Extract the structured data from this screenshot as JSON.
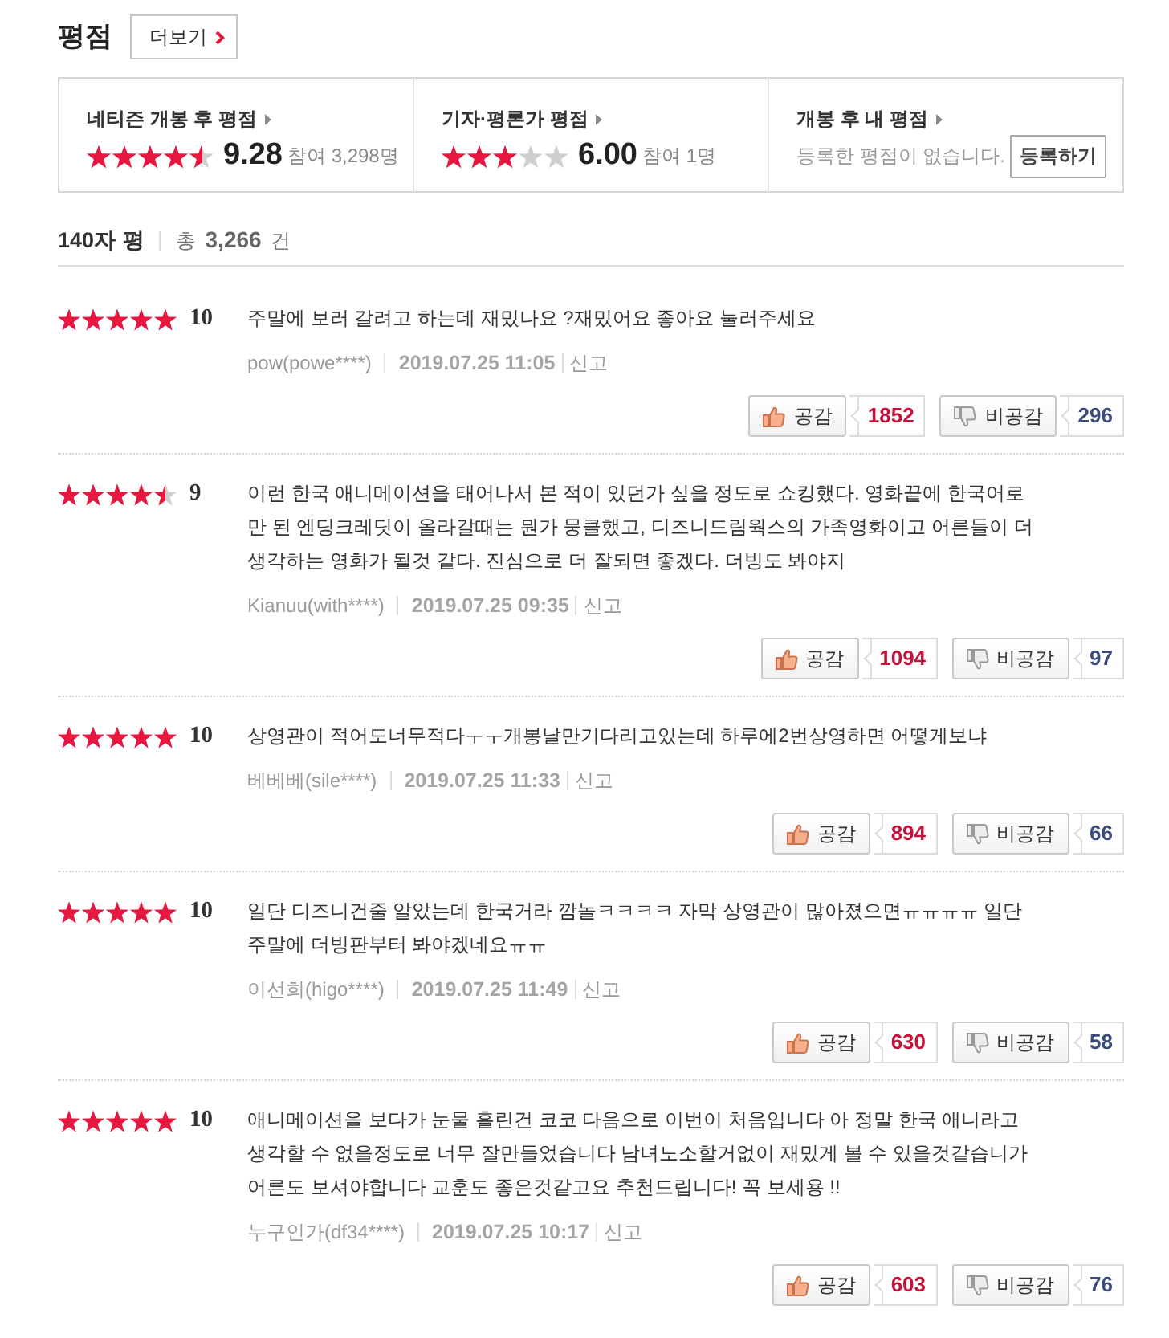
{
  "header": {
    "title": "평점",
    "more_button": "더보기"
  },
  "summary": [
    {
      "kind": "rating",
      "label": "네티즌 개봉 후 평점",
      "stars": 4.5,
      "score": "9.28",
      "participants": "참여 3,298명"
    },
    {
      "kind": "rating",
      "label": "기자·평론가 평점",
      "stars": 3,
      "score": "6.00",
      "participants": "참여 1명"
    },
    {
      "kind": "mine",
      "label": "개봉 후 내 평점",
      "empty_text": "등록한 평점이 없습니다.",
      "button": "등록하기"
    }
  ],
  "list_header": {
    "title": "140자 평",
    "total": "총 **3,266** 건"
  },
  "reviews": [
    {
      "stars": 5,
      "score": "10",
      "text": "주말에 보러 갈려고 하는데 재밌나요 ?재밌어요 좋아요 눌러주세요",
      "author": "pow(powe****)",
      "date": "2019.07.25 11:05",
      "report": "신고",
      "like_label": "공감",
      "likes": "1852",
      "dislike_label": "비공감",
      "dislikes": "296"
    },
    {
      "stars": 4.5,
      "score": "9",
      "text": "이런 한국 애니메이션을 태어나서 본 적이 있던가 싶을 정도로 쇼킹했다. 영화끝에 한국어로 만 된 엔딩크레딧이 올라갈때는 뭔가 뭉클했고, 디즈니드림웍스의 가족영화이고 어른들이 더 생각하는 영화가 될것 같다. 진심으로 더 잘되면 좋겠다. 더빙도 봐야지",
      "author": "Kianuu(with****)",
      "date": "2019.07.25 09:35",
      "report": "신고",
      "like_label": "공감",
      "likes": "1094",
      "dislike_label": "비공감",
      "dislikes": "97"
    },
    {
      "stars": 5,
      "score": "10",
      "text": "상영관이 적어도너무적다ㅜㅜ개봉날만기다리고있는데 하루에2번상영하면 어떻게보냐",
      "author": "베베베(sile****)",
      "date": "2019.07.25 11:33",
      "report": "신고",
      "like_label": "공감",
      "likes": "894",
      "dislike_label": "비공감",
      "dislikes": "66"
    },
    {
      "stars": 5,
      "score": "10",
      "text": "일단 디즈니건줄 알았는데 한국거라 깜놀ㅋㅋㅋㅋ 자막 상영관이 많아졌으면ㅠㅠㅠㅠ 일단 주말에 더빙판부터 봐야겠네요ㅠㅠ",
      "author": "이선희(higo****)",
      "date": "2019.07.25 11:49",
      "report": "신고",
      "like_label": "공감",
      "likes": "630",
      "dislike_label": "비공감",
      "dislikes": "58"
    },
    {
      "stars": 5,
      "score": "10",
      "text": "애니메이션을 보다가 눈물 흘린건 코코 다음으로 이번이 처음입니다 아 정말 한국 애니라고 생각할 수 없을정도로 너무 잘만들었습니다 남녀노소할거없이 재밌게 볼 수 있을것같습니가 어른도 보셔야합니다 교훈도 좋은것같고요 추천드립니다! 꼭 보세용 !!",
      "author": "누구인가(df34****)",
      "date": "2019.07.25 10:17",
      "report": "신고",
      "like_label": "공감",
      "likes": "603",
      "dislike_label": "비공감",
      "dislikes": "76"
    }
  ]
}
